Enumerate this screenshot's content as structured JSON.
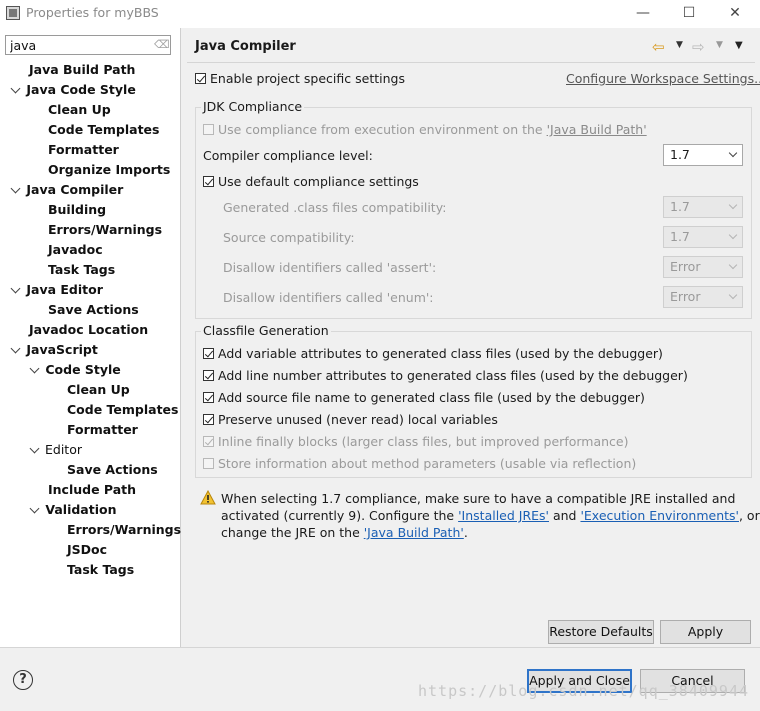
{
  "window": {
    "title": "Properties for myBBS",
    "min": "—",
    "max": "☐",
    "close": "✕"
  },
  "filter": {
    "value": "java"
  },
  "tree": [
    {
      "label": "Java Build Path"
    },
    {
      "label": "Java Code Style"
    },
    {
      "label": "Clean Up"
    },
    {
      "label": "Code Templates"
    },
    {
      "label": "Formatter"
    },
    {
      "label": "Organize Imports"
    },
    {
      "label": "Java Compiler"
    },
    {
      "label": "Building"
    },
    {
      "label": "Errors/Warnings"
    },
    {
      "label": "Javadoc"
    },
    {
      "label": "Task Tags"
    },
    {
      "label": "Java Editor"
    },
    {
      "label": "Save Actions"
    },
    {
      "label": "Javadoc Location"
    },
    {
      "label": "JavaScript"
    },
    {
      "label": "Code Style"
    },
    {
      "label": "Clean Up"
    },
    {
      "label": "Code Templates"
    },
    {
      "label": "Formatter"
    },
    {
      "label": "Editor"
    },
    {
      "label": "Save Actions"
    },
    {
      "label": "Include Path"
    },
    {
      "label": "Validation"
    },
    {
      "label": "Errors/Warnings"
    },
    {
      "label": "JSDoc"
    },
    {
      "label": "Task Tags"
    }
  ],
  "page": {
    "title": "Java Compiler",
    "enable_specific": "Enable project specific settings",
    "configure_workspace": "Configure Workspace Settings..."
  },
  "jdk": {
    "title": "JDK Compliance",
    "use_compliance_prefix": "Use compliance from execution environment on the ",
    "use_compliance_link": "'Java Build Path'",
    "level_label": "Compiler compliance level:",
    "level_value": "1.7",
    "use_default": "Use default compliance settings",
    "generated_label": "Generated .class files compatibility:",
    "generated_value": "1.7",
    "source_label": "Source compatibility:",
    "source_value": "1.7",
    "assert_label": "Disallow identifiers called 'assert':",
    "assert_value": "Error",
    "enum_label": "Disallow identifiers called 'enum':",
    "enum_value": "Error"
  },
  "classfile": {
    "title": "Classfile Generation",
    "opt1": "Add variable attributes to generated class files (used by the debugger)",
    "opt2": "Add line number attributes to generated class files (used by the debugger)",
    "opt3": "Add source file name to generated class file (used by the debugger)",
    "opt4": "Preserve unused (never read) local variables",
    "opt5": "Inline finally blocks (larger class files, but improved performance)",
    "opt6": "Store information about method parameters (usable via reflection)"
  },
  "warning": {
    "line1": "When selecting 1.7 compliance, make sure to have a compatible JRE installed and",
    "line2_a": "activated (currently 9). Configure the ",
    "line2_link1": "'Installed JREs'",
    "line2_b": " and ",
    "line2_link2": "'Execution Environments'",
    "line2_c": ", or",
    "line3_a": "change the JRE on the ",
    "line3_link": "'Java Build Path'",
    "line3_b": "."
  },
  "buttons": {
    "restore": "Restore Defaults",
    "apply": "Apply",
    "apply_close": "Apply and Close",
    "cancel": "Cancel",
    "help": "?"
  },
  "watermark": "https://blog.csdn.net/qq_38409944",
  "colors": {
    "link": "#1a5fb4",
    "default_button_border": "#2f74c9",
    "warning": "#f2c230"
  }
}
